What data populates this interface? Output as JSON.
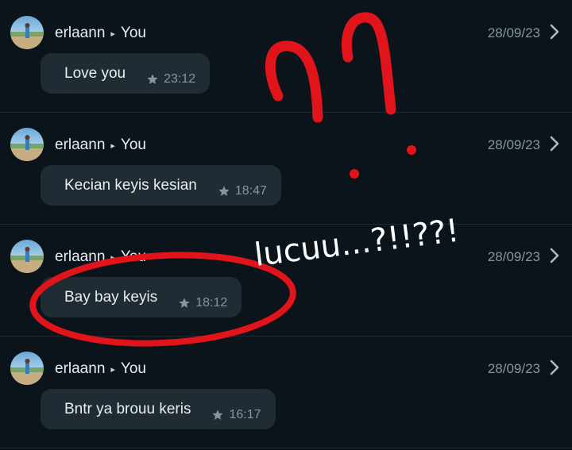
{
  "colors": {
    "background": "#0b141a",
    "bubble": "#1f2c34",
    "muted_text": "#8696a0",
    "annotation_red": "#e0141a"
  },
  "icons": {
    "star": "star-icon",
    "chevron": "chevron-right-icon",
    "arrow": "play-arrow-icon"
  },
  "messages": [
    {
      "sender": "erlaann",
      "recipient": "You",
      "date": "28/09/23",
      "text": "Love you",
      "time": "23:12"
    },
    {
      "sender": "erlaann",
      "recipient": "You",
      "date": "28/09/23",
      "text": "Kecian keyis kesian",
      "time": "18:47"
    },
    {
      "sender": "erlaann",
      "recipient": "You",
      "date": "28/09/23",
      "text": "Bay bay keyis",
      "time": "18:12"
    },
    {
      "sender": "erlaann",
      "recipient": "You",
      "date": "28/09/23",
      "text": "Bntr ya brouu keris",
      "time": "16:17"
    }
  ],
  "annotation": {
    "handwritten_text": "lucuu...?!!??!"
  }
}
